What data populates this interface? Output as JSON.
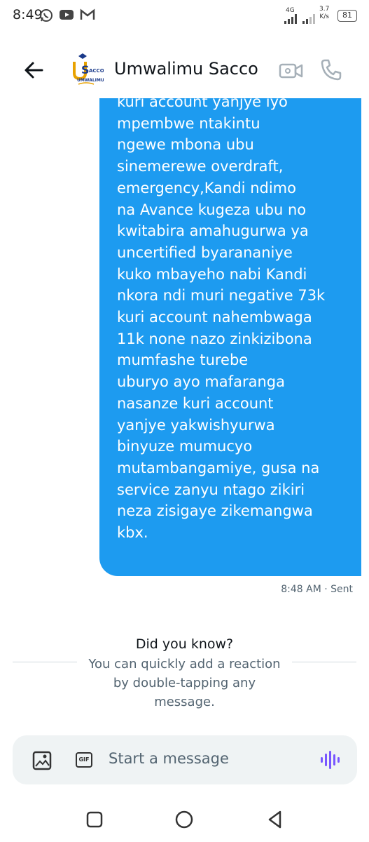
{
  "status_bar": {
    "time": "8:49",
    "network": "4G",
    "speed_value": "3.7",
    "speed_unit": "K/s",
    "battery": "81"
  },
  "header": {
    "contact_name": "Umwalimu Sacco",
    "avatar_text_top": "USacco",
    "avatar_text_bottom": "UMWALIMU"
  },
  "message": {
    "text": "kuri account yanjye iyo\nmpembwe ntakintu\nngewe mbona ubu\nsinemerewe overdraft,\nemergency,Kandi ndimo\nna Avance kugeza ubu no\nkwitabira amahugurwa ya\nuncertified byarananiye\nkuko mbayeho nabi Kandi\nnkora ndi muri negative 73k\nkuri account nahembwaga\n11k none nazo zinkizibona\nmumfashe turebe\nuburyo ayo mafaranga\nnasanze kuri account\nyanjye yakwishyurwa\nbinyuze mumucyo\nmutambangamiye, gusa na\nservice zanyu ntago zikiri\nneza zisigaye zikemangwa\nkbx.",
    "meta": "8:48 AM · Sent"
  },
  "tip": {
    "title": "Did you know?",
    "body": "You can quickly add a reaction by double-tapping any message."
  },
  "composer": {
    "placeholder": "Start a message",
    "gif_label": "GIF"
  },
  "colors": {
    "bubble": "#1d9bf0",
    "voice_icon": "#7856ff"
  }
}
